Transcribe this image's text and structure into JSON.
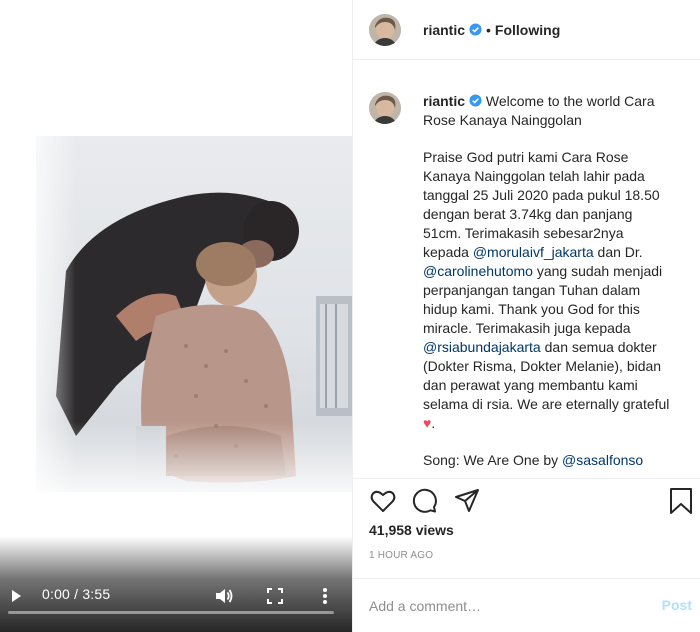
{
  "video": {
    "time": "0:00 / 3:55",
    "progress_fraction": 0.0,
    "icons": [
      "play-icon",
      "volume-icon",
      "fullscreen-icon",
      "more-vertical-icon"
    ]
  },
  "header": {
    "username": "riantic",
    "separator": "•",
    "follow_state": "Following"
  },
  "caption": {
    "username": "riantic",
    "title": "Welcome to the world Cara Rose Kanaya Nainggolan",
    "p1_a": "Praise God putri kami Cara Rose Kanaya Nainggolan telah lahir pada tanggal 25 Juli 2020 pada pukul 18.50 dengan berat 3.74kg dan panjang 51cm. Terimakasih sebesar2nya kepada ",
    "mention1": "@morulaivf_jakarta",
    "p1_b": " dan Dr. ",
    "mention2": "@carolinehutomo",
    "p1_c": " yang sudah menjadi perpanjangan tangan Tuhan dalam hidup kami. Thank you God for this miracle. Terimakasih juga kepada ",
    "mention3": "@rsiabundajakarta",
    "p1_d": " dan semua dokter (Dokter Risma, Dokter Melanie), bidan dan perawat yang membantu kami selama di rsia. We are eternally grateful ",
    "heart": "♥",
    "p1_e": ".",
    "p2_a": "Song: We Are One by ",
    "mention4": "@sasalfonso"
  },
  "actions": {
    "icons": [
      "heart-icon",
      "comment-icon",
      "share-icon",
      "bookmark-icon"
    ]
  },
  "stats": {
    "views": "41,958 views",
    "time_ago": "1 HOUR AGO"
  },
  "comment_box": {
    "placeholder": "Add a comment…",
    "post_label": "Post"
  },
  "colors": {
    "link": "#00376b",
    "verified": "#3897f0",
    "heart": "#ed4956",
    "post_disabled": "#b2dffc",
    "muted": "#8e8e8e"
  }
}
